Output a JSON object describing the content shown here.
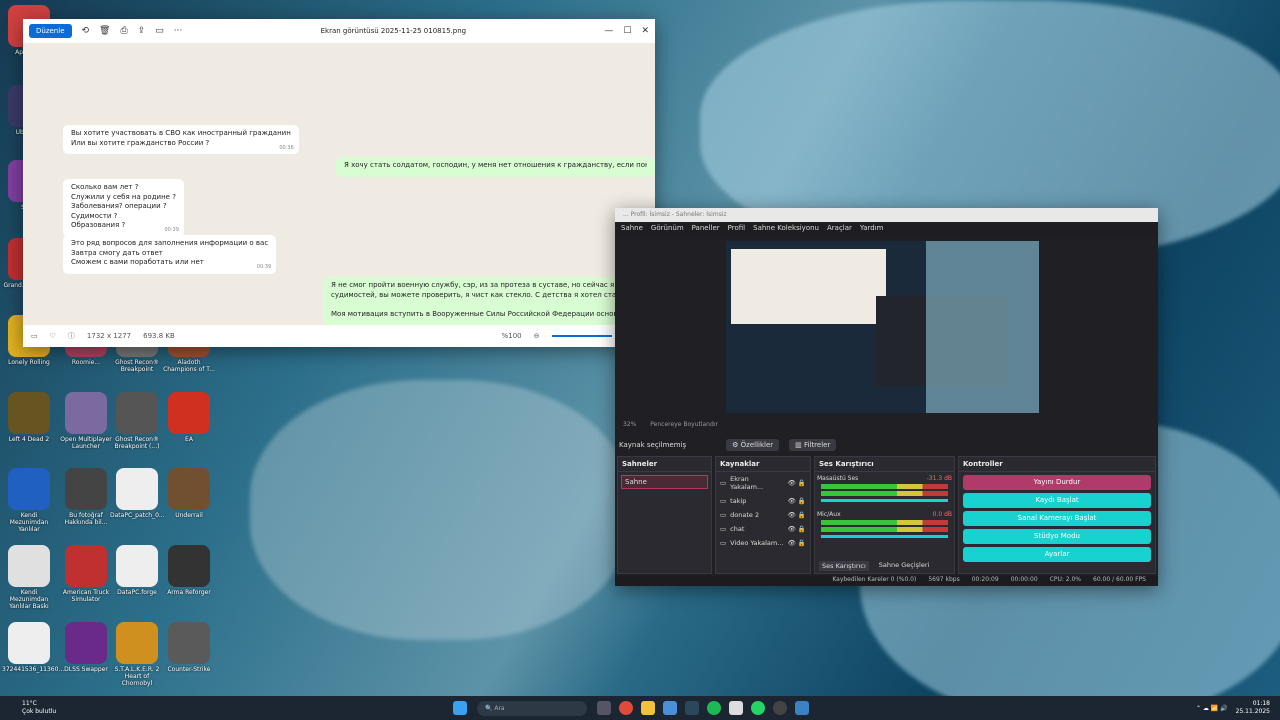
{
  "desktop": {
    "icons": [
      {
        "label": "Applica..."
      },
      {
        "label": "Ubisoft..."
      },
      {
        "label": "Store"
      },
      {
        "label": "Grand... Blacks..."
      },
      {
        "label": "Lonely Rolling"
      },
      {
        "label": "Roomie..."
      },
      {
        "label": "Ghost Recon® Breakpoint"
      },
      {
        "label": "Aladoth Champions of T..."
      },
      {
        "label": "Left 4 Dead 2"
      },
      {
        "label": "Open Multiplayer Launcher"
      },
      {
        "label": "Ghost Recon® Breakpoint (...)"
      },
      {
        "label": "EA"
      },
      {
        "label": "Kendi Mezunimdan Yanlılar"
      },
      {
        "label": "Bu fotoğraf Hakkında bil..."
      },
      {
        "label": "DataPC_patch_0..."
      },
      {
        "label": "Underrail"
      },
      {
        "label": "Kendi Mezunimdan Yanlılar Baskı"
      },
      {
        "label": "American Truck Simulator"
      },
      {
        "label": "DataPC.forge"
      },
      {
        "label": "Arma Reforger"
      },
      {
        "label": "372441536_11360..."
      },
      {
        "label": "DLSS Swapper"
      },
      {
        "label": "S.T.A.L.K.E.R. 2 Heart of Chornobyl"
      },
      {
        "label": "Counter-Strike"
      }
    ]
  },
  "photos": {
    "edit_label": "Düzenle",
    "title": "Ekran görüntüsü 2025-11-25 010815.png",
    "messages": [
      {
        "dir": "in",
        "lines": [
          "Вы хотите участвовать в СВО как иностранный гражданин",
          "Или вы хотите гражданство России ?"
        ],
        "time": "00:36"
      },
      {
        "dir": "out",
        "lines": [
          "Я хочу стать солдатом, господин, у меня нет отношения к гражданству, если понадобится, я го"
        ],
        "time": ""
      },
      {
        "dir": "in",
        "lines": [
          "Сколько вам лет ?",
          "Служили у себя на родине ?",
          "Заболевания? операции ?",
          "Судимости ?",
          "Образования ?"
        ],
        "time": "00:39"
      },
      {
        "dir": "in",
        "lines": [
          "Это ряд вопросов для заполнения информации о вас",
          "Завтра смогу дать ответ",
          "Сможем с вами поработать или нет"
        ],
        "time": "00:39"
      },
      {
        "dir": "out",
        "lines": [
          "Я не смог пройти военную службу, сэр, из за протеза в суставе, но сейчас я очень хорошо бегаю и",
          "судимостей, вы можете проверить, я чист как стекло. С детства я хотел стать членом спецназа, се",
          "",
          "Моя мотивация вступить в Вооруженные Силы Российской Федерации основана на глубокой при"
        ],
        "time": ""
      }
    ],
    "footer": {
      "resolution": "1732 x 1277",
      "size": "693.8 KB",
      "zoom": "%100"
    }
  },
  "obs": {
    "title": "... Profil: İsimsiz - Sahneler: İsimsiz",
    "menu": [
      "Sahne",
      "Görünüm",
      "Paneller",
      "Profil",
      "Sahne Koleksiyonu",
      "Araçlar",
      "Yardım"
    ],
    "zoom_label": "32%",
    "fit_label": "Pencereye Boyutlandır",
    "no_source": "Kaynak seçilmemiş",
    "props": "Özellikler",
    "filters": "Filtreler",
    "scenes_title": "Sahneler",
    "scene": "Sahne",
    "sources_title": "Kaynaklar",
    "sources": [
      "Ekran Yakalam...",
      "takip",
      "donate 2",
      "chat",
      "Video Yakalam..."
    ],
    "mixer_title": "Ses Karıştırıcı",
    "mixer": [
      {
        "name": "Masaüstü Ses",
        "db": "-31.3 dB"
      },
      {
        "name": "Mic/Aux",
        "db": "0.0 dB"
      }
    ],
    "mixer_tab": "Ses Karıştırıcı",
    "transitions_tab": "Sahne Geçişleri",
    "controls_title": "Kontroller",
    "controls": [
      "Yayını Durdur",
      "Kaydı Başlat",
      "Sanal Kamerayı Başlat",
      "Stüdyo Modu",
      "Ayarlar"
    ],
    "status": {
      "dropped": "Kaybedilen Kareler 0 (%0.0)",
      "bitrate": "5697 kbps",
      "live": "00:20:09",
      "rec": "00:00:00",
      "cpu": "CPU: 2.0%",
      "fps": "60.00 / 60.00 FPS"
    }
  },
  "taskbar": {
    "weather_temp": "11°C",
    "weather_desc": "Çok bulutlu",
    "search": "Ara",
    "time": "01:18",
    "date": "25.11.2025"
  }
}
